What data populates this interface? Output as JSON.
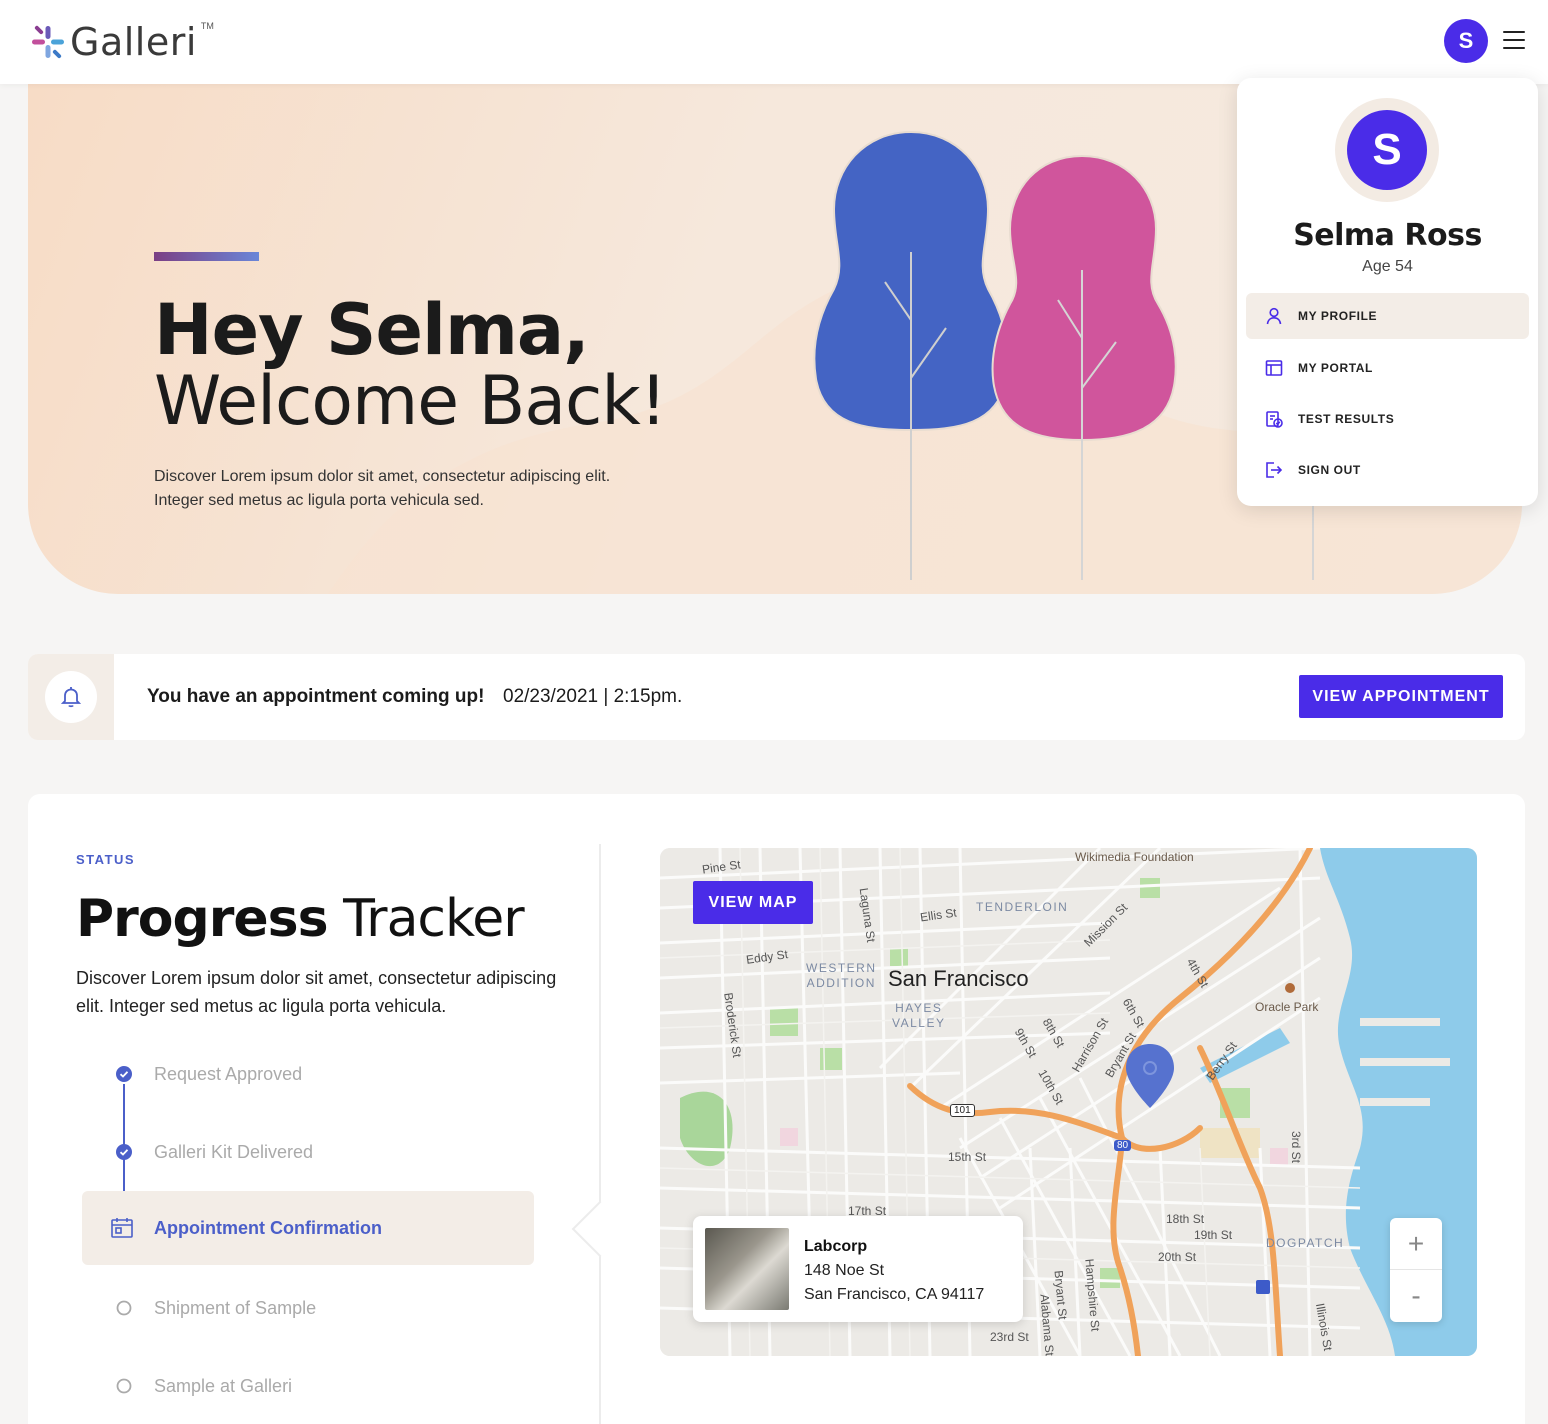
{
  "header": {
    "logo_text": "Galleri",
    "logo_tm": "TM",
    "avatar_initial": "S"
  },
  "hero": {
    "title": "Hey Selma,",
    "subtitle": "Welcome Back!",
    "description": "Discover Lorem ipsum dolor sit amet, consectetur adipiscing elit. Integer sed metus ac ligula porta vehicula sed."
  },
  "profile_menu": {
    "initial": "S",
    "name": "Selma Ross",
    "age": "Age 54",
    "items": [
      {
        "label": "MY PROFILE",
        "icon": "user-icon",
        "active": true
      },
      {
        "label": "MY PORTAL",
        "icon": "portal-icon",
        "active": false
      },
      {
        "label": "TEST RESULTS",
        "icon": "clipboard-check-icon",
        "active": false
      },
      {
        "label": "SIGN OUT",
        "icon": "sign-out-icon",
        "active": false
      }
    ]
  },
  "appointment": {
    "message": "You have an appointment coming up!",
    "datetime": "02/23/2021 | 2:15pm.",
    "button_label": "VIEW APPOINTMENT"
  },
  "status": {
    "label": "STATUS",
    "title_bold": "Progress",
    "title_light": "Tracker",
    "description": "Discover Lorem ipsum dolor sit amet, consectetur adipiscing elit. Integer sed metus ac ligula porta vehicula.",
    "steps": [
      {
        "label": "Request Approved",
        "state": "done"
      },
      {
        "label": "Galleri Kit Delivered",
        "state": "done"
      },
      {
        "label": "Appointment Confirmation",
        "state": "current"
      },
      {
        "label": "Shipment of Sample",
        "state": "pending"
      },
      {
        "label": "Sample at Galleri",
        "state": "pending"
      }
    ]
  },
  "map": {
    "button_label": "VIEW MAP",
    "city": "San Francisco",
    "labels": {
      "pine": "Pine St",
      "wikimedia": "Wikimedia Foundation",
      "tenderloin": "TENDERLOIN",
      "ellis": "Ellis St",
      "eddy": "Eddy St",
      "laguna": "Laguna St",
      "western_addition": "WESTERN\nADDITION",
      "hayes_valley": "HAYES\nVALLEY",
      "mission": "Mission St",
      "fourth": "4th St",
      "oracle": "Oracle Park",
      "broderick": "Broderick St",
      "eighth": "8th St",
      "ninth": "9th St",
      "sixth": "6th St",
      "harrison": "Harrison St",
      "bryant": "Bryant St",
      "berry": "Berry St",
      "tenth": "10th St",
      "fifteenth": "15th St",
      "seventeenth": "17th St",
      "eighteenth": "18th St",
      "nineteenth": "19th St",
      "twentieth": "20th St",
      "twentythird": "23rd St",
      "third": "3rd St",
      "dogpatch": "DOGPATCH",
      "hampshire": "Hampshire St",
      "bryant2": "Bryant St",
      "alabama": "Alabama St",
      "illinois": "Illinois St",
      "hwy101": "101",
      "hwy80": "80"
    },
    "location": {
      "name": "Labcorp",
      "address_line1": "148 Noe St",
      "address_line2": "San Francisco, CA 94117"
    },
    "zoom_in": "+",
    "zoom_out": "-"
  },
  "colors": {
    "accent": "#4a2ce8",
    "status_blue": "#4b5fc9",
    "tree_blue": "#4464c4",
    "tree_pink": "#d0559c",
    "water": "#8ecbea",
    "highway": "#f0a25a"
  }
}
